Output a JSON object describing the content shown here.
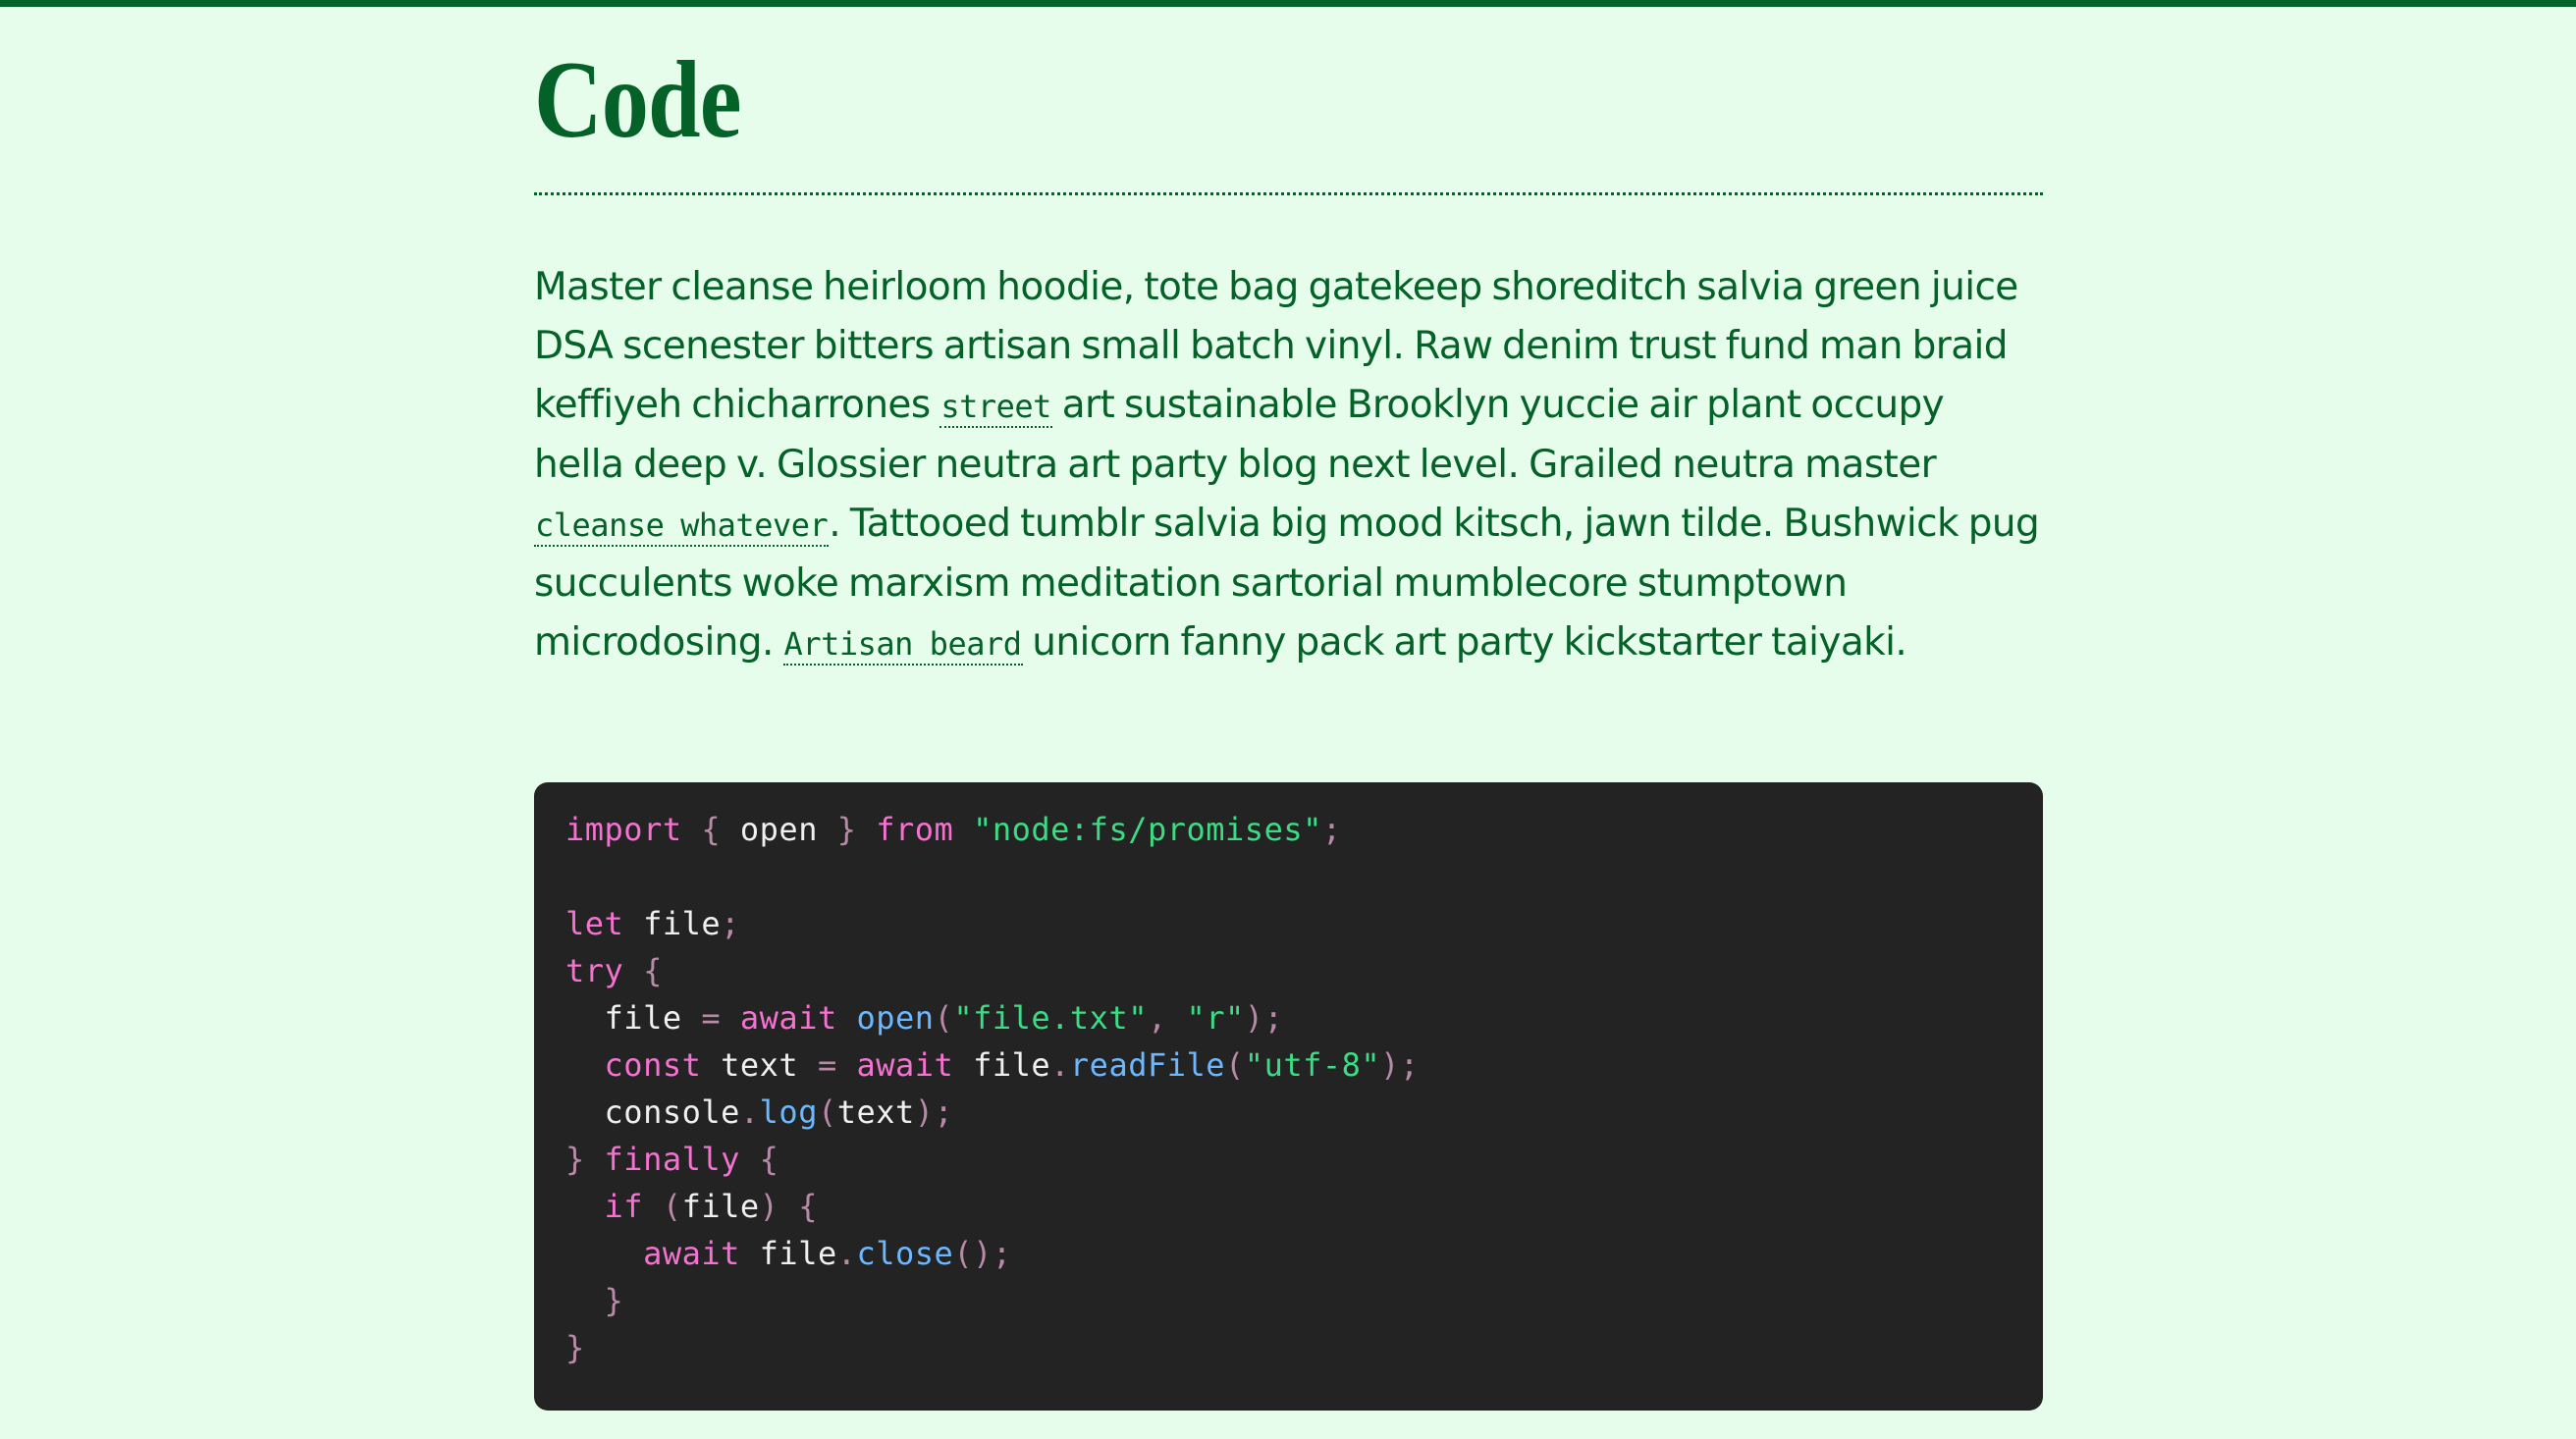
{
  "page": {
    "title": "Code",
    "paragraph": [
      {
        "type": "text",
        "value": "Master cleanse heirloom hoodie, tote bag gatekeep shoreditch salvia green juice DSA scenester bitters artisan small batch vinyl. Raw denim trust fund man braid keffiyeh chicharrones "
      },
      {
        "type": "code",
        "value": "street"
      },
      {
        "type": "text",
        "value": " art sustainable Brooklyn yuccie air plant occupy hella deep v. Glossier neutra art party blog next level. Grailed neutra master "
      },
      {
        "type": "code",
        "value": "cleanse whatever"
      },
      {
        "type": "text",
        "value": ". Tattooed tumblr salvia big mood kitsch, jawn tilde. Bushwick pug succulents woke marxism meditation sartorial mumblecore stumptown microdosing. "
      },
      {
        "type": "code",
        "value": "Artisan beard"
      },
      {
        "type": "text",
        "value": " unicorn fanny pack art party kickstarter taiyaki."
      }
    ]
  },
  "code_block": {
    "language": "javascript",
    "lines": [
      [
        [
          "kw",
          "import"
        ],
        [
          "plain",
          " "
        ],
        [
          "punc",
          "{"
        ],
        [
          "plain",
          " open "
        ],
        [
          "punc",
          "}"
        ],
        [
          "plain",
          " "
        ],
        [
          "kw",
          "from"
        ],
        [
          "plain",
          " "
        ],
        [
          "str",
          "\"node:fs/promises\""
        ],
        [
          "punc",
          ";"
        ]
      ],
      [],
      [
        [
          "kw",
          "let"
        ],
        [
          "plain",
          " file"
        ],
        [
          "punc",
          ";"
        ]
      ],
      [
        [
          "kw",
          "try"
        ],
        [
          "plain",
          " "
        ],
        [
          "punc",
          "{"
        ]
      ],
      [
        [
          "plain",
          "  file "
        ],
        [
          "punc",
          "="
        ],
        [
          "plain",
          " "
        ],
        [
          "kw",
          "await"
        ],
        [
          "plain",
          " "
        ],
        [
          "fn",
          "open"
        ],
        [
          "punc",
          "("
        ],
        [
          "str",
          "\"file.txt\""
        ],
        [
          "punc",
          ","
        ],
        [
          "plain",
          " "
        ],
        [
          "str",
          "\"r\""
        ],
        [
          "punc",
          ");"
        ]
      ],
      [
        [
          "plain",
          "  "
        ],
        [
          "kw",
          "const"
        ],
        [
          "plain",
          " text "
        ],
        [
          "punc",
          "="
        ],
        [
          "plain",
          " "
        ],
        [
          "kw",
          "await"
        ],
        [
          "plain",
          " file"
        ],
        [
          "punc",
          "."
        ],
        [
          "fn",
          "readFile"
        ],
        [
          "punc",
          "("
        ],
        [
          "str",
          "\"utf-8\""
        ],
        [
          "punc",
          ");"
        ]
      ],
      [
        [
          "plain",
          "  console"
        ],
        [
          "punc",
          "."
        ],
        [
          "fn",
          "log"
        ],
        [
          "punc",
          "("
        ],
        [
          "plain",
          "text"
        ],
        [
          "punc",
          ");"
        ]
      ],
      [
        [
          "punc",
          "}"
        ],
        [
          "plain",
          " "
        ],
        [
          "kw",
          "finally"
        ],
        [
          "plain",
          " "
        ],
        [
          "punc",
          "{"
        ]
      ],
      [
        [
          "plain",
          "  "
        ],
        [
          "kw",
          "if"
        ],
        [
          "plain",
          " "
        ],
        [
          "punc",
          "("
        ],
        [
          "plain",
          "file"
        ],
        [
          "punc",
          ")"
        ],
        [
          "plain",
          " "
        ],
        [
          "punc",
          "{"
        ]
      ],
      [
        [
          "plain",
          "    "
        ],
        [
          "kw",
          "await"
        ],
        [
          "plain",
          " file"
        ],
        [
          "punc",
          "."
        ],
        [
          "fn",
          "close"
        ],
        [
          "punc",
          "();"
        ]
      ],
      [
        [
          "plain",
          "  "
        ],
        [
          "punc",
          "}"
        ]
      ],
      [
        [
          "punc",
          "}"
        ]
      ]
    ]
  },
  "colors": {
    "background": "#e6fdec",
    "text": "#046228",
    "code_background": "#232323",
    "keyword": "#f472d0",
    "string": "#3ddc84",
    "function": "#6cb8ff",
    "punctuation": "#b98aa8",
    "plain": "#f0f0f0"
  }
}
